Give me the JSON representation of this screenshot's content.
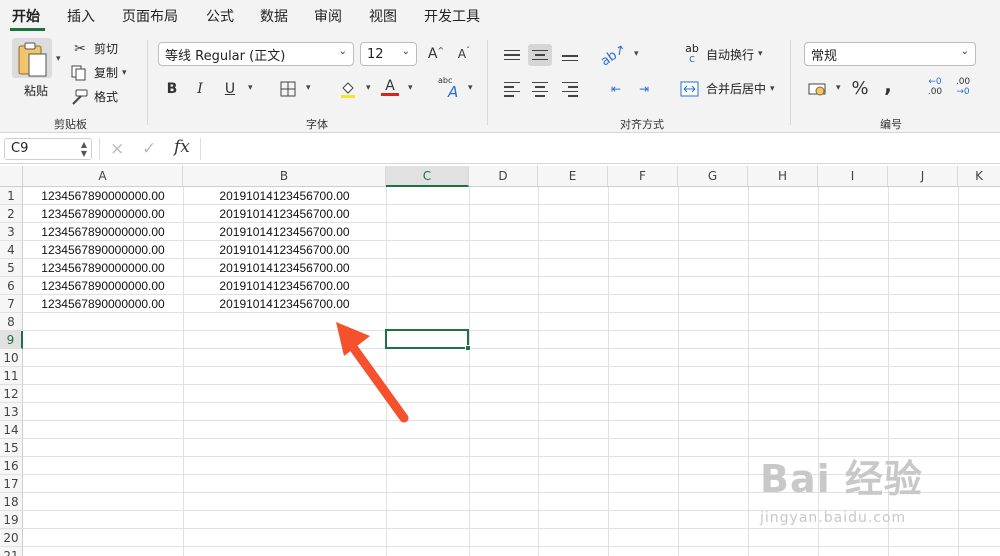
{
  "menu": {
    "tabs": [
      "开始",
      "插入",
      "页面布局",
      "公式",
      "数据",
      "审阅",
      "视图",
      "开发工具"
    ],
    "active_tab": "开始"
  },
  "ribbon": {
    "clipboard": {
      "paste_label": "粘贴",
      "cut_label": "剪切",
      "copy_label": "复制",
      "format_label": "格式",
      "group_label": "剪贴板"
    },
    "font": {
      "font_name": "等线 Regular (正文)",
      "font_size": "12",
      "grow_label": "A",
      "shrink_label": "A",
      "bold_label": "B",
      "italic_label": "I",
      "underline_label": "U",
      "font_color_label": "A",
      "phonetic_label": "abc",
      "phonetic_a": "A",
      "group_label": "字体",
      "highlight_color": "#f5e625",
      "font_color": "#d9241c"
    },
    "alignment": {
      "wrap_label": "自动换行",
      "merge_label": "合并后居中",
      "wrap_icon_text": "ab",
      "wrap_icon_text2": "c",
      "group_label": "对齐方式"
    },
    "number": {
      "format": "常规",
      "percent_label": "%",
      "comma_label": ",",
      "inc_top": "←0",
      "inc_bottom": ".00",
      "dec_top": ".00",
      "dec_bottom": "→0",
      "group_label": "编号"
    }
  },
  "formula_bar": {
    "name_box": "C9",
    "cancel_icon": "×",
    "enter_icon": "✓",
    "fx_label": "fx",
    "formula": ""
  },
  "sheet": {
    "columns": [
      "A",
      "B",
      "C",
      "D",
      "E",
      "F",
      "G",
      "H",
      "I",
      "J",
      "K"
    ],
    "rows": [
      "1",
      "2",
      "3",
      "4",
      "5",
      "6",
      "7",
      "8",
      "9",
      "10",
      "11",
      "12",
      "13",
      "14",
      "15",
      "16",
      "17",
      "18",
      "19",
      "20",
      "21"
    ],
    "active_cell": "C9",
    "cells": [
      [
        "1234567890000000.00",
        "20191014123456700.00"
      ],
      [
        "1234567890000000.00",
        "20191014123456700.00"
      ],
      [
        "1234567890000000.00",
        "20191014123456700.00"
      ],
      [
        "1234567890000000.00",
        "20191014123456700.00"
      ],
      [
        "1234567890000000.00",
        "20191014123456700.00"
      ],
      [
        "1234567890000000.00",
        "20191014123456700.00"
      ],
      [
        "1234567890000000.00",
        "20191014123456700.00"
      ]
    ]
  },
  "annotation": {
    "arrow_color": "#f4512c"
  },
  "watermark": {
    "logo": "Bai 经验",
    "url": "jingyan.baidu.com"
  },
  "theme": {
    "accent": "#1e7145"
  }
}
